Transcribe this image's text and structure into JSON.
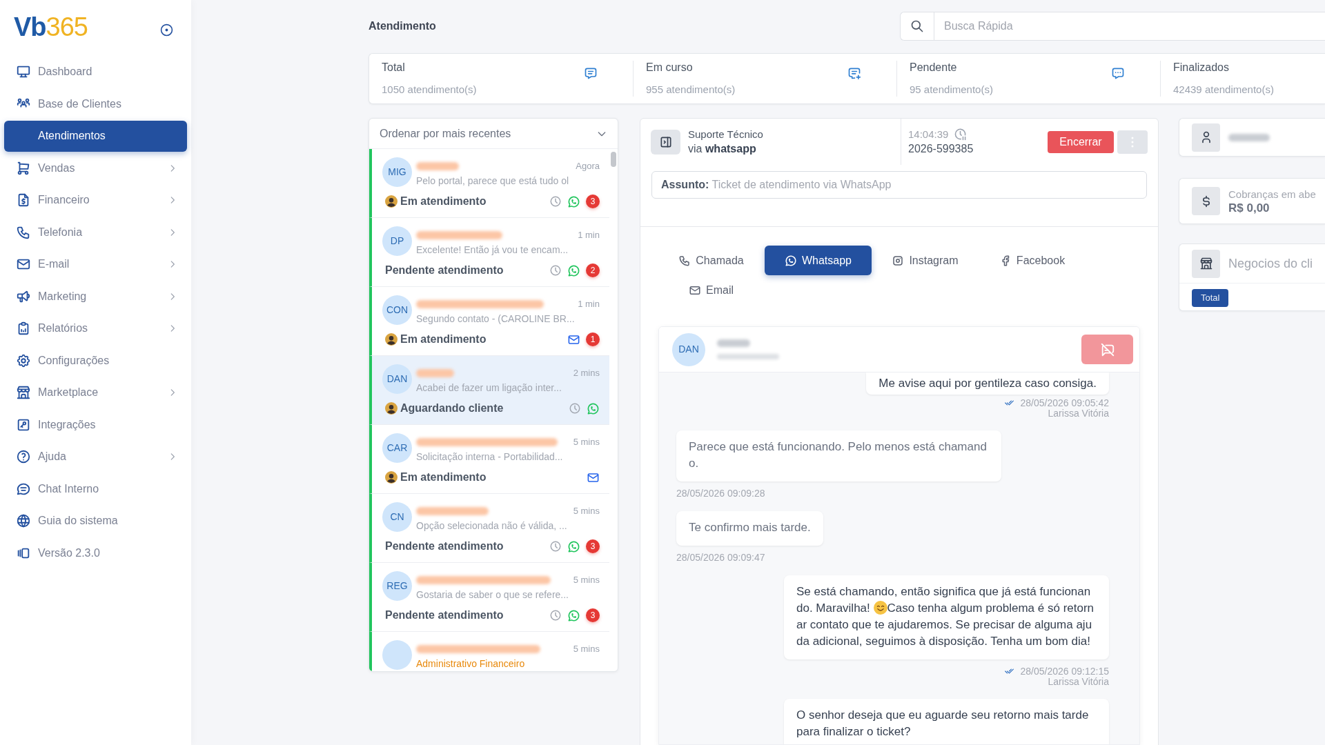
{
  "sidebar": {
    "logo": {
      "part_1": "Vb",
      "part_2": "365"
    },
    "items": [
      {
        "label": "Dashboard",
        "has_submenu": false,
        "selected": false
      },
      {
        "label": "Base de Clientes",
        "has_submenu": false,
        "selected": false
      },
      {
        "label": "Atendimentos",
        "has_submenu": false,
        "selected": true
      },
      {
        "label": "Vendas",
        "has_submenu": true,
        "selected": false
      },
      {
        "label": "Financeiro",
        "has_submenu": true,
        "selected": false
      },
      {
        "label": "Telefonia",
        "has_submenu": true,
        "selected": false
      },
      {
        "label": "E-mail",
        "has_submenu": true,
        "selected": false
      },
      {
        "label": "Marketing",
        "has_submenu": true,
        "selected": false
      },
      {
        "label": "Relatórios",
        "has_submenu": true,
        "selected": false
      },
      {
        "label": "Configurações",
        "has_submenu": false,
        "selected": false
      },
      {
        "label": "Marketplace",
        "has_submenu": true,
        "selected": false
      },
      {
        "label": "Integrações",
        "has_submenu": false,
        "selected": false
      },
      {
        "label": "Ajuda",
        "has_submenu": true,
        "selected": false
      },
      {
        "label": "Chat Interno",
        "has_submenu": false,
        "selected": false
      },
      {
        "label": "Guia do sistema",
        "has_submenu": false,
        "selected": false
      },
      {
        "label": "Versão 2.3.0",
        "has_submenu": false,
        "selected": false
      }
    ]
  },
  "header": {
    "title": "Atendimento",
    "search": {
      "placeholder": "Busca Rápida"
    }
  },
  "stats": [
    {
      "label": "Total",
      "value": "1050 atendimento(s)"
    },
    {
      "label": "Em curso",
      "value": "955 atendimento(s)"
    },
    {
      "label": "Pendente",
      "value": "95 atendimento(s)"
    },
    {
      "label": "Finalizados",
      "value": "42439 atendimento(s)"
    }
  ],
  "ticket_list": {
    "sort": "Ordenar por mais recentes",
    "tickets": [
      {
        "initials": "MIG",
        "time": "Agora",
        "preview": "Pelo portal, parece que está tudo ol",
        "status": "Em atendimento",
        "agent_avatar": true,
        "timer": true,
        "kind": "whatsapp",
        "unread": "3",
        "selected": false
      },
      {
        "initials": "DP",
        "time": "1 min",
        "preview": "Excelente! Então já vou te encam...",
        "status": "Pendente atendimento",
        "agent_avatar": false,
        "timer": true,
        "kind": "whatsapp",
        "unread": "2",
        "selected": false
      },
      {
        "initials": "CON",
        "time": "1 min",
        "preview": "Segundo contato - (CAROLINE BR...",
        "status": "Em atendimento",
        "agent_avatar": true,
        "timer": false,
        "kind": "email",
        "unread": "1",
        "selected": false
      },
      {
        "initials": "DAN",
        "time": "2 mins",
        "preview": "Acabei de fazer um ligação inter...",
        "status": "Aguardando cliente",
        "agent_avatar": true,
        "timer": true,
        "kind": "whatsapp",
        "selected": true
      },
      {
        "initials": "CAR",
        "time": "5 mins",
        "preview": "Solicitação interna - Portabilidad...",
        "status": "Em atendimento",
        "agent_avatar": true,
        "timer": false,
        "kind": "email",
        "selected": false
      },
      {
        "initials": "CN",
        "time": "5 mins",
        "preview": "Opção selecionada não é válida, ...",
        "status": "Pendente atendimento",
        "agent_avatar": false,
        "timer": true,
        "kind": "whatsapp",
        "unread": "3",
        "selected": false
      },
      {
        "initials": "REG",
        "time": "5 mins",
        "preview": "Gostaria de saber o que se refere...",
        "status": "Pendente atendimento",
        "agent_avatar": false,
        "timer": true,
        "kind": "whatsapp",
        "unread": "3",
        "selected": false
      },
      {
        "time": "5 mins",
        "department": "Administrativo Financeiro",
        "selected": false
      }
    ]
  },
  "conversation": {
    "queue": "Suporte Técnico",
    "channel_line": "via **whatsapp**",
    "duration": "14:04:39",
    "protocol": "2026-599385",
    "close_button": "Encerrar",
    "subject": "**Assunto:** Ticket de atendimento via WhatsApp",
    "tabs": [
      {
        "label": "Chamada",
        "selected": false
      },
      {
        "label": "Whatsapp",
        "selected": true
      },
      {
        "label": "Instagram",
        "selected": false
      },
      {
        "label": "Facebook",
        "selected": false
      },
      {
        "label": "Email",
        "selected": false
      }
    ],
    "contact": {
      "initials": "DAN"
    },
    "messages": [
      {
        "kind": "outgoing",
        "segments": [
          "Me avise aqui por gentileza caso consiga."
        ],
        "time": "28/05/2026 09:05:42",
        "author": "Larissa Vitória",
        "read": true
      },
      {
        "kind": "incoming",
        "segments": [
          "Parece que está funcionando. Pelo menos está chamando."
        ],
        "time": "28/05/2026 09:09:28"
      },
      {
        "kind": "incoming",
        "segments": [
          "Te confirmo mais tarde."
        ],
        "time": "28/05/2026 09:09:47"
      },
      {
        "kind": "outgoing",
        "segments": [
          "Se está chamando, então significa que já está funcionando. Maravilha! ",
          "Caso tenha algum problema é só retornar contato que te ajudaremos. Se precisar de alguma ajuda adicional, seguimos à disposição. Tenha um bom dia!"
        ],
        "time": "28/05/2026 09:12:15",
        "author": "Larissa Vitória",
        "read": true
      },
      {
        "kind": "outgoing",
        "segments": [
          "O senhor deseja que eu aguarde seu retorno mais tarde para finalizar o ticket?"
        ]
      }
    ]
  },
  "client_panel": {
    "charges": {
      "label": "Cobranças em abe",
      "value": "R$ 0,00"
    },
    "deals": {
      "title": "Negocios do cli",
      "tab": "Total"
    }
  }
}
